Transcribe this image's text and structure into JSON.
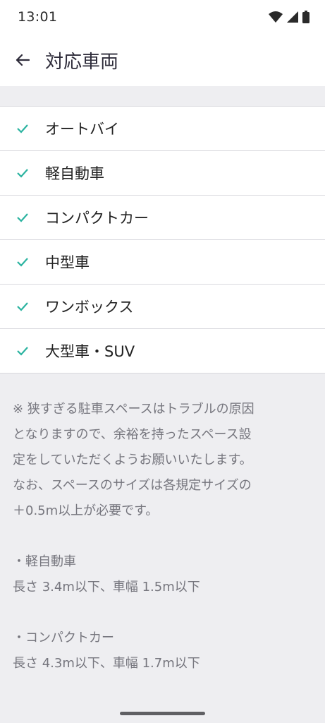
{
  "status_bar": {
    "time": "13:01"
  },
  "header": {
    "title": "対応車両"
  },
  "vehicles": [
    {
      "label": "オートバイ"
    },
    {
      "label": "軽自動車"
    },
    {
      "label": "コンパクトカー"
    },
    {
      "label": "中型車"
    },
    {
      "label": "ワンボックス"
    },
    {
      "label": "大型車・SUV"
    }
  ],
  "note": {
    "paragraph": [
      "※ 狭すぎる駐車スペースはトラブルの原因",
      "となりますので、余裕を持ったスペース設",
      "定をしていただくようお願いいたします。",
      "なお、スペースのサイズは各規定サイズの",
      "＋0.5m以上が必要です。"
    ],
    "sections": [
      {
        "heading": "・軽自動車",
        "size": "長さ 3.4m以下、車幅 1.5m以下"
      },
      {
        "heading": "・コンパクトカー",
        "size": "長さ 4.3m以下、車幅 1.7m以下"
      }
    ]
  },
  "colors": {
    "check": "#2bb3a0",
    "background": "#eeeef1"
  }
}
